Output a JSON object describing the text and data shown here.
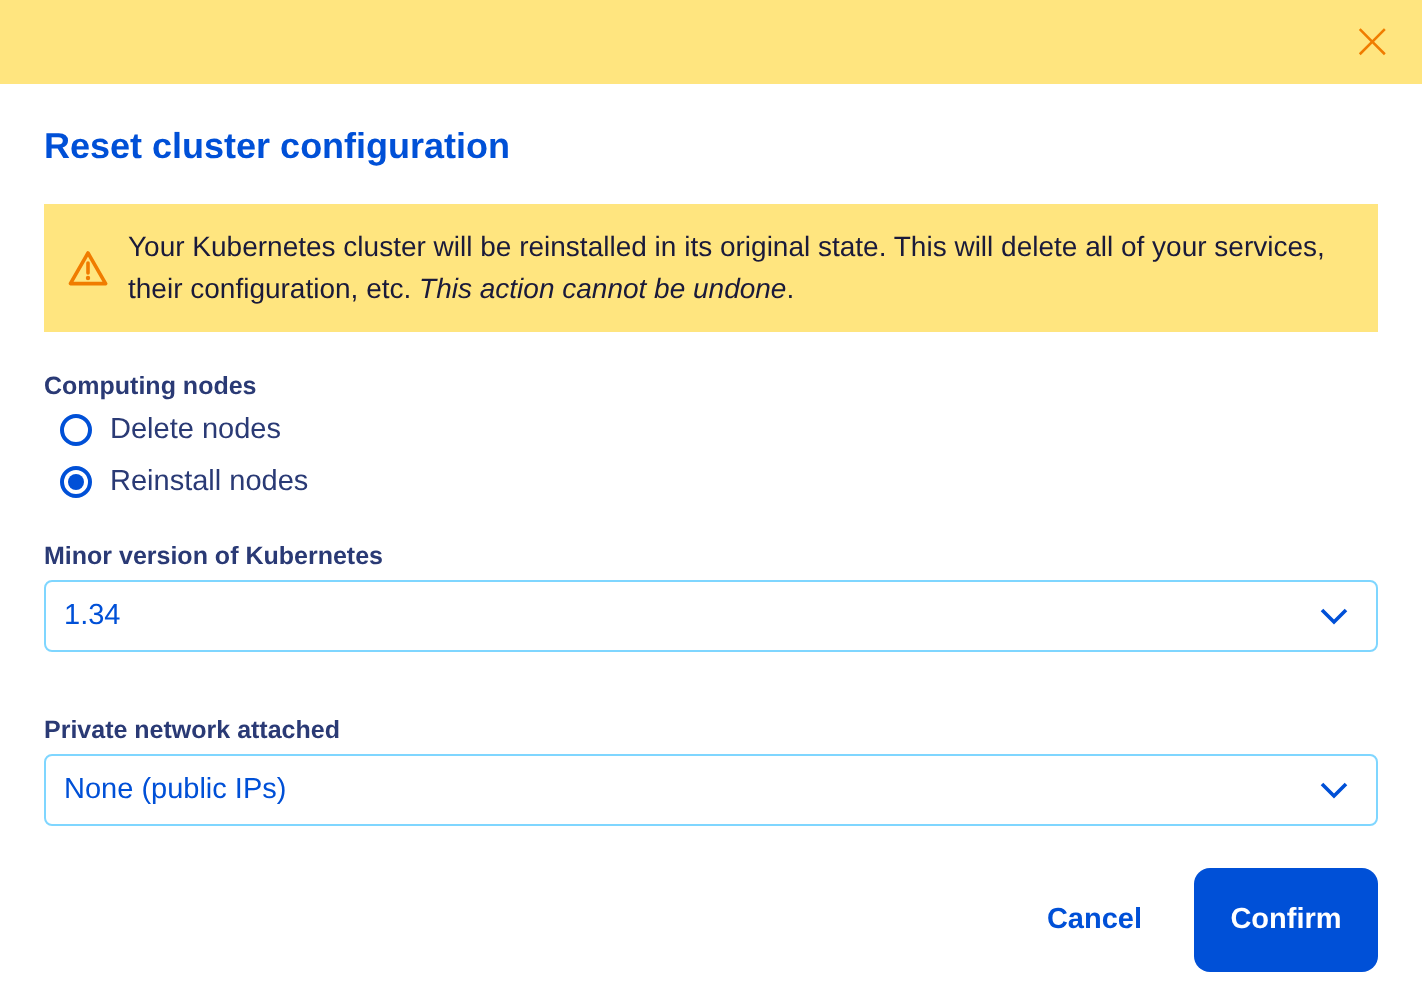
{
  "dialog": {
    "close_button": "×",
    "title": "Reset cluster configuration"
  },
  "warning": {
    "text": "Your Kubernetes cluster will be reinstalled in its original state. This will delete all of your services, their configuration, etc. *This action cannot be undone*."
  },
  "computing_nodes": {
    "label": "Computing nodes",
    "options": [
      {
        "label": "Delete nodes",
        "selected": false
      },
      {
        "label": "Reinstall nodes",
        "selected": true
      }
    ]
  },
  "selects": [
    {
      "label": "Minor version of Kubernetes",
      "value": "1.34"
    },
    {
      "label": "Private network attached",
      "value": "None (public IPs)"
    }
  ],
  "buttons": {
    "cancel": "Cancel",
    "confirm": "Confirm"
  }
}
